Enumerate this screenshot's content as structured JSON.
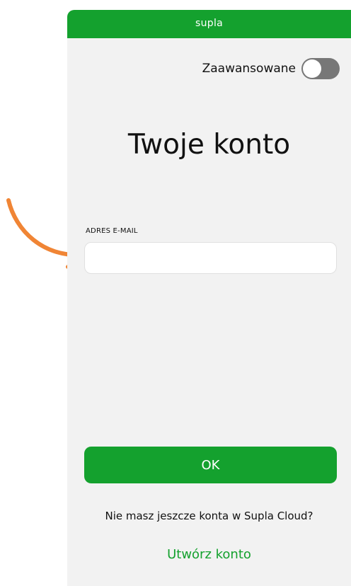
{
  "app": {
    "title": "supla"
  },
  "advanced": {
    "label": "Zaawansowane",
    "enabled": false
  },
  "main": {
    "title": "Twoje konto"
  },
  "email": {
    "label": "ADRES E-MAIL",
    "value": ""
  },
  "actions": {
    "ok_label": "OK",
    "no_account_text": "Nie masz jeszcze konta w Supla Cloud?",
    "create_account_label": "Utwórz konto"
  },
  "annotation": {
    "arrow_icon": "curved-arrow-icon"
  },
  "colors": {
    "brand_green": "#14a12e",
    "background": "#f2f2f2",
    "toggle_off": "#777777",
    "arrow": "#f08535"
  }
}
